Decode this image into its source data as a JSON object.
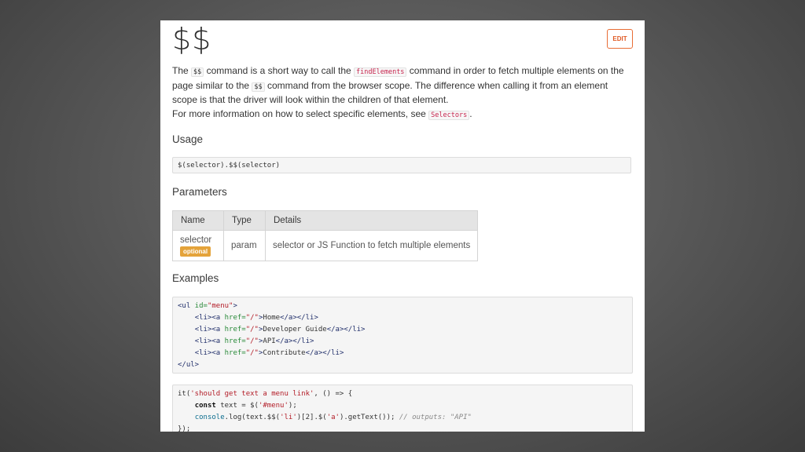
{
  "doc": {
    "title": "$$",
    "edit_label": "EDIT",
    "intro": {
      "p1_a": "The ",
      "p1_code1": "$$",
      "p1_b": " command is a short way to call the ",
      "p1_code2": "findElements",
      "p1_c": " command in order to fetch multiple elements on the page similar to the ",
      "p1_code3": "$$",
      "p1_d": " command from the browser scope. The difference when calling it from an element scope is that the driver will look within the children of that element.",
      "p2_a": "For more information on how to select specific elements, see ",
      "p2_code": "Selectors",
      "p2_b": "."
    },
    "usage_heading": "Usage",
    "usage_code": "$(selector).$$(selector)",
    "parameters_heading": "Parameters",
    "params_table": {
      "headers": [
        "Name",
        "Type",
        "Details"
      ],
      "rows": [
        {
          "name": "selector",
          "badge": "optional",
          "type": "param",
          "details": "selector or JS Function to fetch multiple elements"
        }
      ]
    },
    "examples_heading": "Examples",
    "example_html": {
      "open_ul": "<ul",
      "id_attr": " id=",
      "id_val": "\"menu\"",
      "close_bracket": ">",
      "li_open": "<li><a",
      "href_attr": " href=",
      "href_val": "\"/\"",
      "items": [
        "Home",
        "Developer Guide",
        "API",
        "Contribute"
      ],
      "li_close": "</a></li>",
      "close_ul": "</ul>"
    },
    "example_js": {
      "l1_a": "it(",
      "l1_str": "'should get text a menu link'",
      "l1_b": ", () => {",
      "l2_kw": "const",
      "l2_a": " text = $(",
      "l2_str": "'#menu'",
      "l2_b": ");",
      "l3_fn": "console",
      "l3_a": ".log(text.$$(",
      "l3_str1": "'li'",
      "l3_b": ")[2].$(",
      "l3_str2": "'a'",
      "l3_c": ").getText()); ",
      "l3_com": "// outputs: \"API\"",
      "l4": "});"
    }
  }
}
